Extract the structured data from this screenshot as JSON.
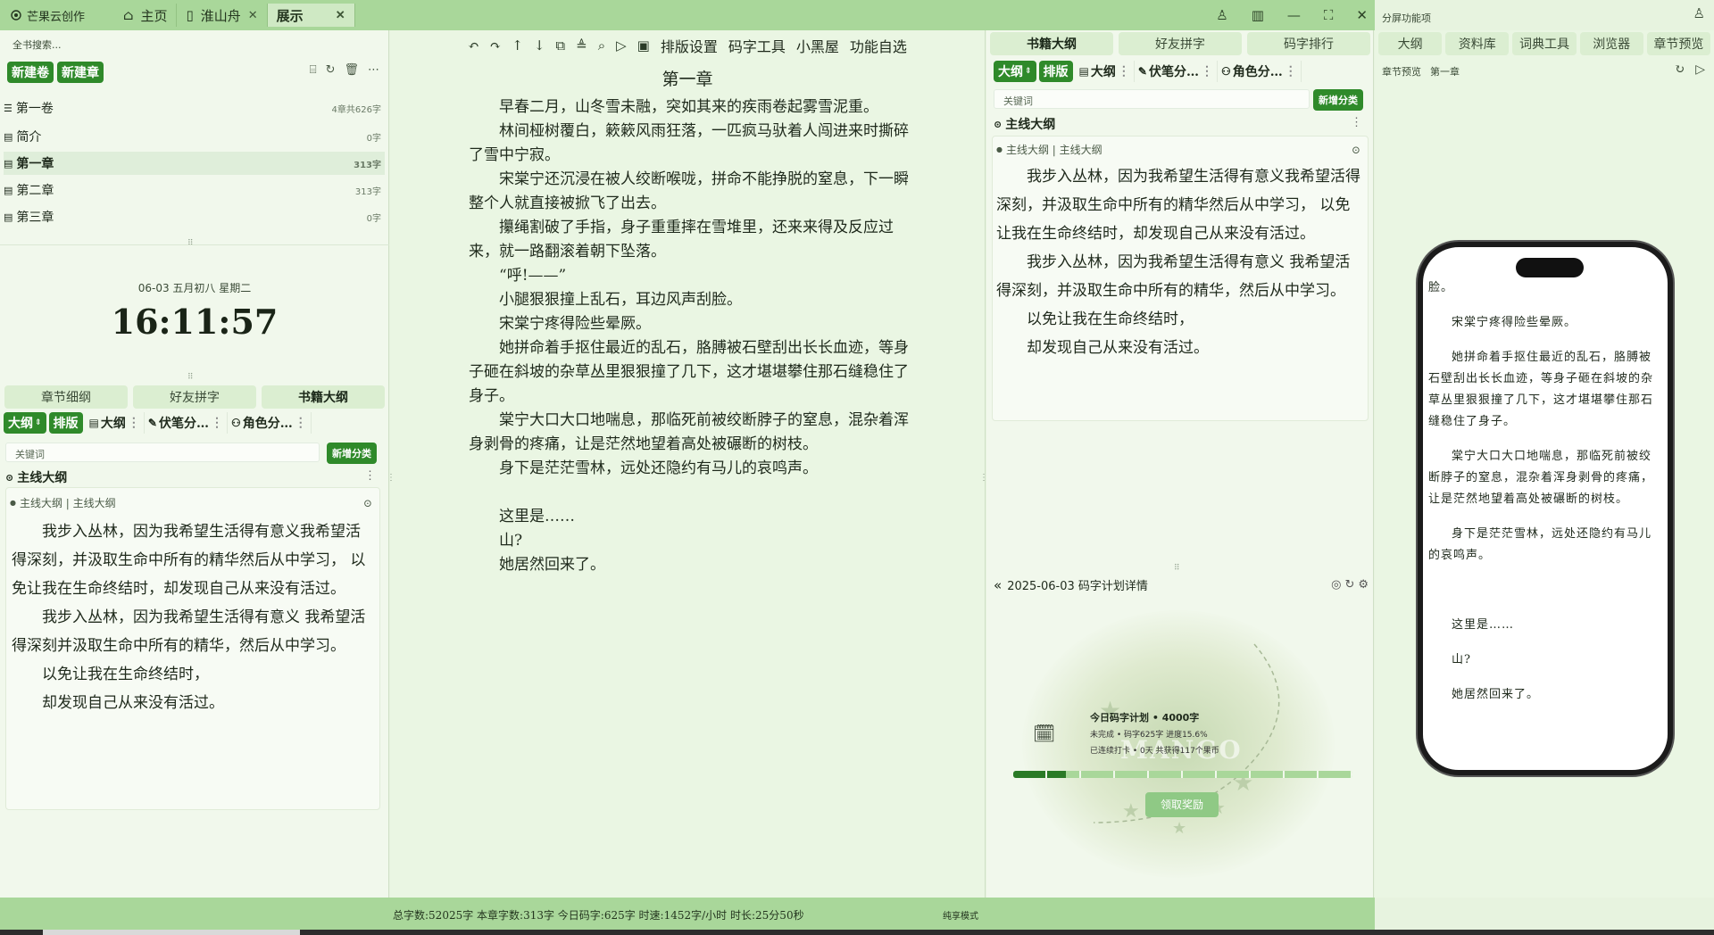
{
  "app": {
    "name": "芒果云创作",
    "tabs": [
      {
        "label": "主页"
      },
      {
        "label": "淮山舟"
      },
      {
        "label": "展示"
      }
    ]
  },
  "split_title": "分屏功能项",
  "left": {
    "search_placeholder": "全书搜索...",
    "new_volume": "新建卷",
    "new_chapter": "新建章",
    "tree": [
      {
        "label": "第一卷",
        "count": "4章共626字"
      },
      {
        "label": "简介",
        "count": "0字"
      },
      {
        "label": "第一章",
        "count": "313字"
      },
      {
        "label": "第二章",
        "count": "313字"
      },
      {
        "label": "第三章",
        "count": "0字"
      }
    ],
    "date": "06-03  五月初八  星期二",
    "clock": "16:11:57",
    "tabs": [
      "章节细纲",
      "好友拼字",
      "书籍大纲"
    ],
    "chips": [
      "大纲",
      "排版",
      "大纲",
      "伏笔分…",
      "角色分…"
    ],
    "keyword_placeholder": "关键词",
    "add_category": "新增分类",
    "outline_title": "主线大纲",
    "outline_crumb": "主线大纲 | 主线大纲",
    "outline_paras": [
      "我步入丛林，因为我希望生活得有意义我希望活得深刻，并汲取生命中所有的精华然后从中学习，   以免让我在生命终结时，却发现自己从来没有活过。",
      "我步入丛林，因为我希望生活得有意义   我希望活得深刻并汲取生命中所有的精华，然后从中学习。",
      "以免让我在生命终结时，",
      "却发现自己从来没有活过。"
    ]
  },
  "editor": {
    "toolbar": [
      "排版设置",
      "码字工具",
      "小黑屋",
      "功能自选"
    ],
    "chapter_title": "第一章",
    "paras": [
      "早春二月，山冬雪未融，突如其来的疾雨卷起雾雪泥重。",
      "林间桠树覆白，簌簌风雨狂落，一匹疯马驮着人闯进来时撕碎了雪中宁寂。",
      "宋棠宁还沉浸在被人绞断喉咙，拼命不能挣脱的窒息，下一瞬整个人就直接被掀飞了出去。",
      "攥绳割破了手指，身子重重摔在雪堆里，还来来得及反应过来，就一路翻滚着朝下坠落。",
      "“呼!——”",
      "小腿狠狠撞上乱石，耳边风声刮脸。",
      "宋棠宁疼得险些晕厥。",
      "她拼命着手抠住最近的乱石，胳膊被石壁刮出长长血迹，等身子砸在斜坡的杂草丛里狠狠撞了几下，这才堪堪攀住那石缝稳住了身子。",
      "棠宁大口大口地喘息，那临死前被绞断脖子的窒息，混杂着浑身剥骨的疼痛，让是茫然地望着高处被碾断的树枝。",
      "身下是茫茫雪林，远处还隐约有马儿的哀鸣声。",
      "",
      "这里是……",
      "山?",
      "她居然回来了。"
    ]
  },
  "right": {
    "tabs": [
      "书籍大纲",
      "好友拼字",
      "码字排行"
    ],
    "chips": [
      "大纲",
      "排版",
      "大纲",
      "伏笔分…",
      "角色分…"
    ],
    "keyword_placeholder": "关键词",
    "add_category": "新增分类",
    "outline_title": "主线大纲",
    "outline_crumb": "主线大纲 | 主线大纲",
    "outline_paras": [
      "我步入丛林，因为我希望生活得有意义我希望活得深刻，并汲取生命中所有的精华然后从中学习，   以免让我在生命终结时，却发现自己从来没有活过。",
      "我步入丛林，因为我希望生活得有意义   我希望活得深刻，并汲取生命中所有的精华，然后从中学习。",
      "以免让我在生命终结时，",
      "却发现自己从来没有活过。"
    ],
    "plan_header": "2025-06-03 码字计划详情",
    "plan_title": "今日码字计划  •  4000字",
    "plan_status": "未完成  •  码字625字 进度15.6%",
    "plan_streak": "已连续打卡  •  0天  共获得117个果币",
    "plan_progress": 0.156,
    "claim_button": "领取奖励",
    "watermark": "MANGO"
  },
  "far": {
    "tabs": [
      "大纲",
      "资料库",
      "词典工具",
      "浏览器",
      "章节预览"
    ],
    "preview_label": "章节预览",
    "preview_chapter": "第一章",
    "phone_paras": [
      "脸。",
      "宋棠宁疼得险些晕厥。",
      "她拼命着手抠住最近的乱石，胳膊被石壁刮出长长血迹，等身子砸在斜坡的杂草丛里狠狠撞了几下，这才堪堪攀住那石缝稳住了身子。",
      "棠宁大口大口地喘息，那临死前被绞断脖子的窒息，混杂着浑身剥骨的疼痛，让是茫然地望着高处被碾断的树枝。",
      "身下是茫茫雪林，远处还隐约有马儿的哀鸣声。",
      "",
      "这里是……",
      "山?",
      "她居然回来了。"
    ]
  },
  "status": {
    "stats": "总字数:52025字   本章字数:313字   今日码字:625字   时速:1452字/小时   时长:25分50秒",
    "mode": "纯享模式"
  },
  "colors": {
    "accent": "#2f8a2a",
    "bar": "#a9d79a",
    "panel": "#f1f8ec"
  }
}
